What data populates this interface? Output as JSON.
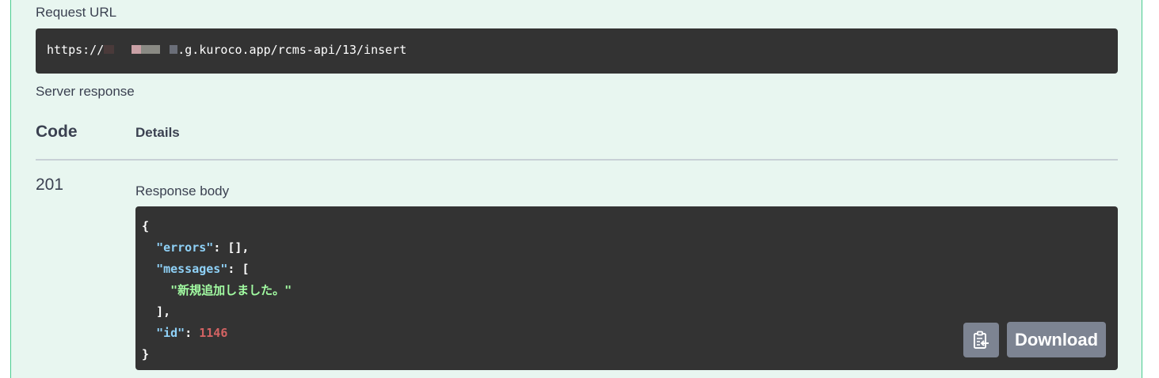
{
  "request_url": {
    "label": "Request URL",
    "prefix": "https://",
    "suffix": ".g.kuroco.app/rcms-api/13/insert",
    "redaction_colors": [
      "#4a3a3a",
      "#c9a0a5",
      "#8a8a84",
      "#6a6e78"
    ]
  },
  "server_response": {
    "label": "Server response",
    "col_code": "Code",
    "col_details": "Details",
    "code": "201",
    "body_label": "Response body",
    "json": {
      "open_brace": "{",
      "errors_key": "\"errors\"",
      "errors_value": "[],",
      "messages_key": "\"messages\"",
      "messages_open": "[",
      "message_item": "\"新規追加しました。\"",
      "messages_close": "],",
      "id_key": "\"id\"",
      "id_value": "1146",
      "close_brace": "}"
    },
    "copy_icon": "clipboard-copy-icon",
    "download_label": "Download"
  },
  "colors": {
    "panel_bg": "#e8f6f0",
    "panel_border": "#49cc90",
    "code_bg": "#333333",
    "button_bg": "#7d8492"
  }
}
